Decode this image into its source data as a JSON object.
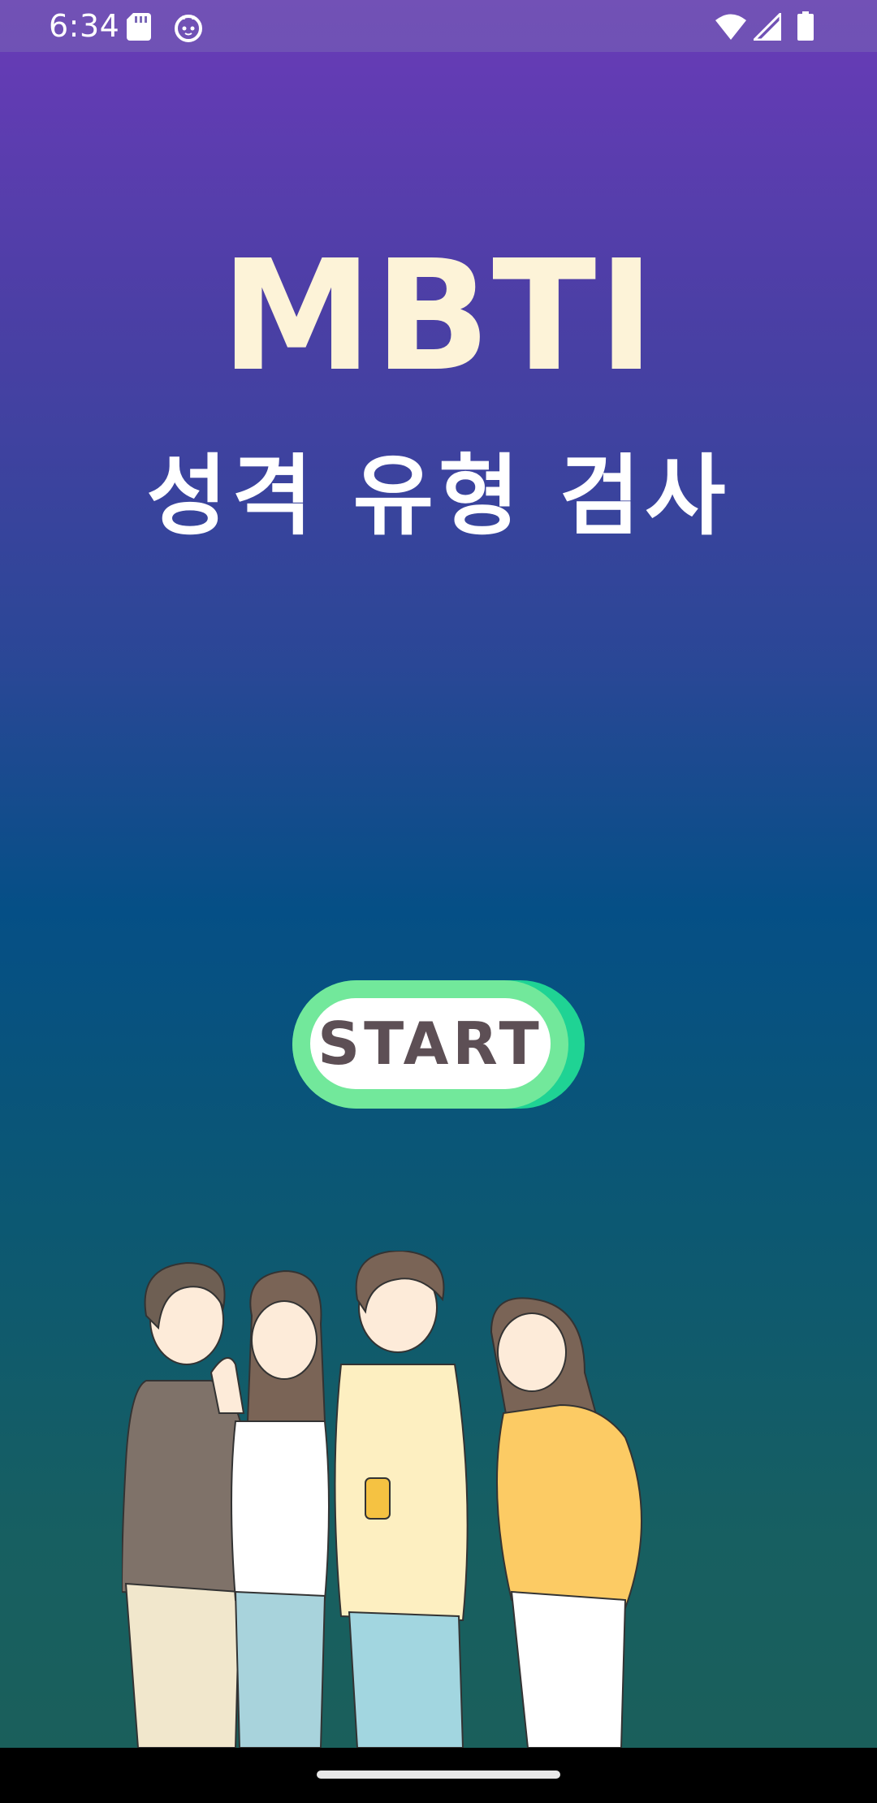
{
  "status_bar": {
    "time": "6:34",
    "icons": [
      "sd-card-icon",
      "cat-face-icon",
      "wifi-icon",
      "cell-signal-icon",
      "battery-icon"
    ]
  },
  "main": {
    "title": "MBTI",
    "subtitle": "성격 유형 검사",
    "start_button_label": "START"
  },
  "illustration": {
    "description_icon": "four-friends-illustration"
  },
  "colors": {
    "title": "#fdf3d8",
    "subtitle": "#ffffff",
    "button_green": "#72e89b",
    "button_shadow": "#1fd394",
    "button_text": "#5d4f55",
    "gradient_top": "#6a3bb8",
    "gradient_mid": "#054f86",
    "gradient_bottom": "#1a5f5b"
  }
}
